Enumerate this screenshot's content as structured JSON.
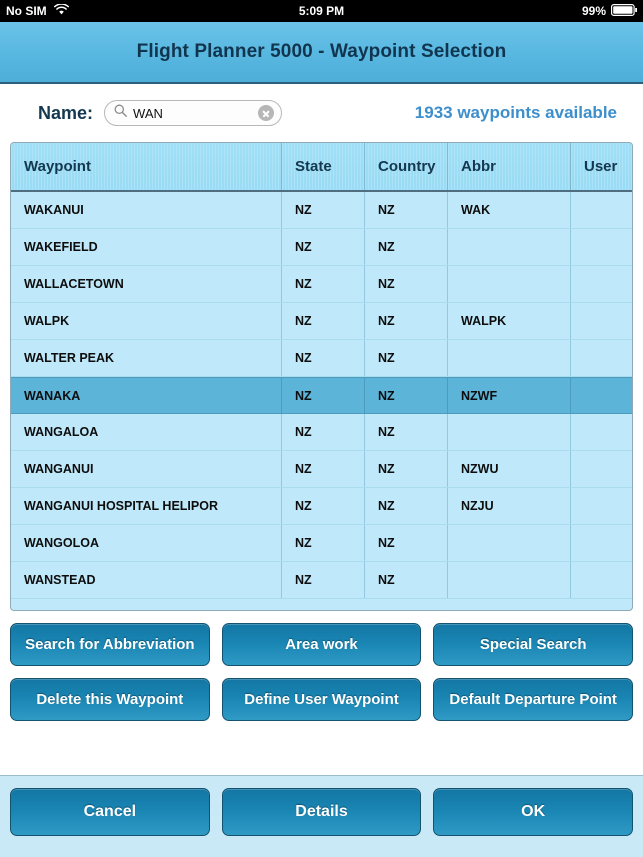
{
  "status_bar": {
    "carrier": "No SIM",
    "wifi_icon": "wifi-icon",
    "time": "5:09 PM",
    "battery_percent": "99%",
    "battery_icon": "battery-icon"
  },
  "header": {
    "title": "Flight Planner 5000 - Waypoint Selection"
  },
  "search": {
    "label": "Name:",
    "icon": "search-icon",
    "value": "WAN",
    "placeholder": "Search",
    "clear_icon": "clear-circle-icon",
    "count_text": "1933 waypoints available"
  },
  "table": {
    "columns": [
      "Waypoint",
      "State",
      "Country",
      "Abbr",
      "User"
    ],
    "rows": [
      {
        "waypoint": "WAKANUI",
        "state": "NZ",
        "country": "NZ",
        "abbr": "WAK",
        "user": "",
        "selected": false
      },
      {
        "waypoint": "WAKEFIELD",
        "state": "NZ",
        "country": "NZ",
        "abbr": "",
        "user": "",
        "selected": false
      },
      {
        "waypoint": "WALLACETOWN",
        "state": "NZ",
        "country": "NZ",
        "abbr": "",
        "user": "",
        "selected": false
      },
      {
        "waypoint": "WALPK",
        "state": "NZ",
        "country": "NZ",
        "abbr": "WALPK",
        "user": "",
        "selected": false
      },
      {
        "waypoint": "WALTER PEAK",
        "state": "NZ",
        "country": "NZ",
        "abbr": "",
        "user": "",
        "selected": false
      },
      {
        "waypoint": "WANAKA",
        "state": "NZ",
        "country": "NZ",
        "abbr": "NZWF",
        "user": "",
        "selected": true
      },
      {
        "waypoint": "WANGALOA",
        "state": "NZ",
        "country": "NZ",
        "abbr": "",
        "user": "",
        "selected": false
      },
      {
        "waypoint": "WANGANUI",
        "state": "NZ",
        "country": "NZ",
        "abbr": "NZWU",
        "user": "",
        "selected": false
      },
      {
        "waypoint": "WANGANUI HOSPITAL HELIPOR",
        "state": "NZ",
        "country": "NZ",
        "abbr": "NZJU",
        "user": "",
        "selected": false
      },
      {
        "waypoint": "WANGOLOA",
        "state": "NZ",
        "country": "NZ",
        "abbr": "",
        "user": "",
        "selected": false
      },
      {
        "waypoint": "WANSTEAD",
        "state": "NZ",
        "country": "NZ",
        "abbr": "",
        "user": "",
        "selected": false
      }
    ]
  },
  "actions": {
    "row1": [
      "Search for Abbreviation",
      "Area work",
      "Special Search"
    ],
    "row2": [
      "Delete this Waypoint",
      "Define User Waypoint",
      "Default Departure Point"
    ]
  },
  "footer": {
    "buttons": [
      "Cancel",
      "Details",
      "OK"
    ]
  },
  "colors": {
    "title_bar": "#57b7e0",
    "table_row": "#bfe9fa",
    "table_header": "#9adcf5",
    "selected_row": "#5cb4d9",
    "button_blue": "#1a86b4",
    "count_text": "#3d8fcc",
    "footer_bg": "#c9e9f6"
  }
}
